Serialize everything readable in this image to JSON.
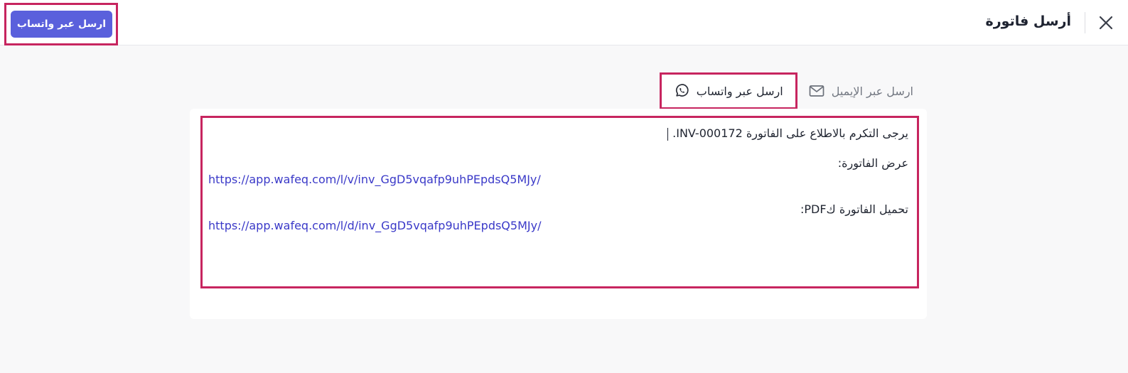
{
  "header": {
    "title": "أرسل فاتورة",
    "close_icon": "close-icon",
    "primary_button_label": "ارسل عبر واتساب"
  },
  "tabs": {
    "email": {
      "label": "ارسل عبر الإيميل",
      "icon": "mail-icon"
    },
    "whatsapp": {
      "label": "ارسل عبر واتساب",
      "icon": "whatsapp-icon"
    }
  },
  "message": {
    "greeting": "يرجى التكرم بالاطلاع على الفاتورة INV-000172.",
    "view_label": "عرض الفاتورة:",
    "view_link": "https://app.wafeq.com/l/v/inv_GgD5vqafp9uhPEpdsQ5MJy/",
    "download_label": "تحميل الفاتورة كPDF:",
    "download_link": "https://app.wafeq.com/l/d/inv_GgD5vqafp9uhPEpdsQ5MJy/"
  },
  "colors": {
    "primary": "#5a60dc",
    "highlight": "#c7255f",
    "link": "#3a39c8"
  }
}
